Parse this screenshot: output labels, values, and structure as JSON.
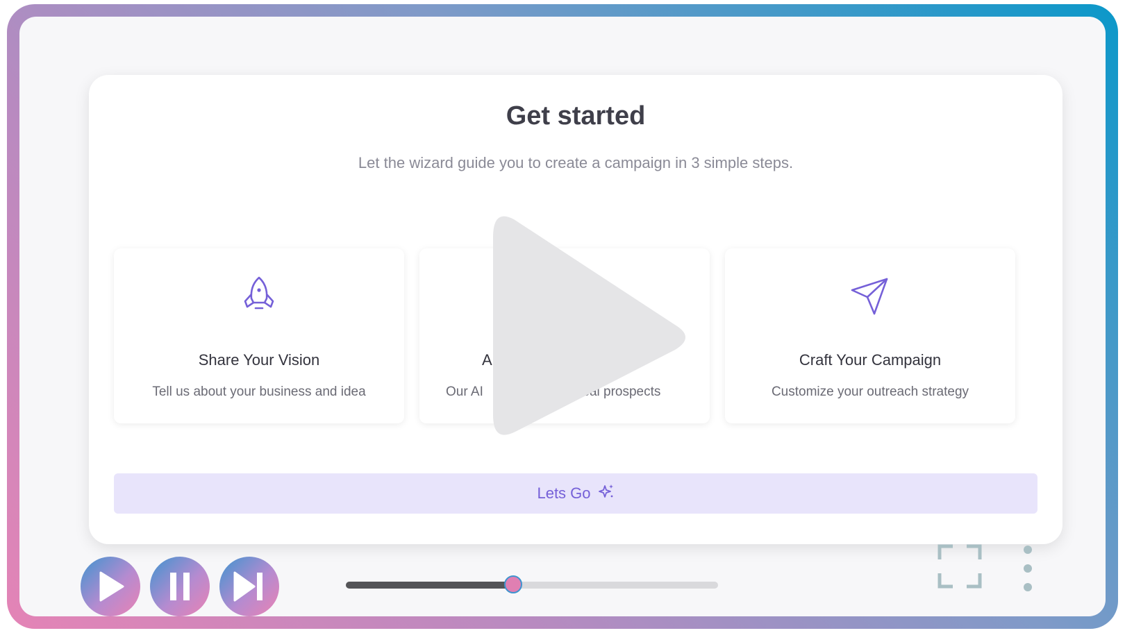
{
  "wizard": {
    "title": "Get started",
    "subtitle": "Let the wizard guide you to create a campaign in 3 simple steps.",
    "steps": [
      {
        "title": "Share Your Vision",
        "description": "Tell us about your business and idea",
        "icon": "rocket-icon"
      },
      {
        "title": "A",
        "description": "Our AI                           eal prospects",
        "icon": "hidden-icon"
      },
      {
        "title": "Craft Your Campaign",
        "description": "Customize your outreach strategy",
        "icon": "paper-plane-icon"
      }
    ],
    "cta_label": "Lets Go",
    "cta_icon": "sparkles-icon"
  },
  "player": {
    "progress": 0.45,
    "buttons": [
      "play-icon",
      "pause-icon",
      "skip-next-icon",
      "fullscreen-icon",
      "more-vertical-icon"
    ]
  },
  "colors": {
    "accent": "#7560d8",
    "cta_bg": "#e8e4fb",
    "gradient_start": "#e484b6",
    "gradient_end": "#0b98c9"
  }
}
